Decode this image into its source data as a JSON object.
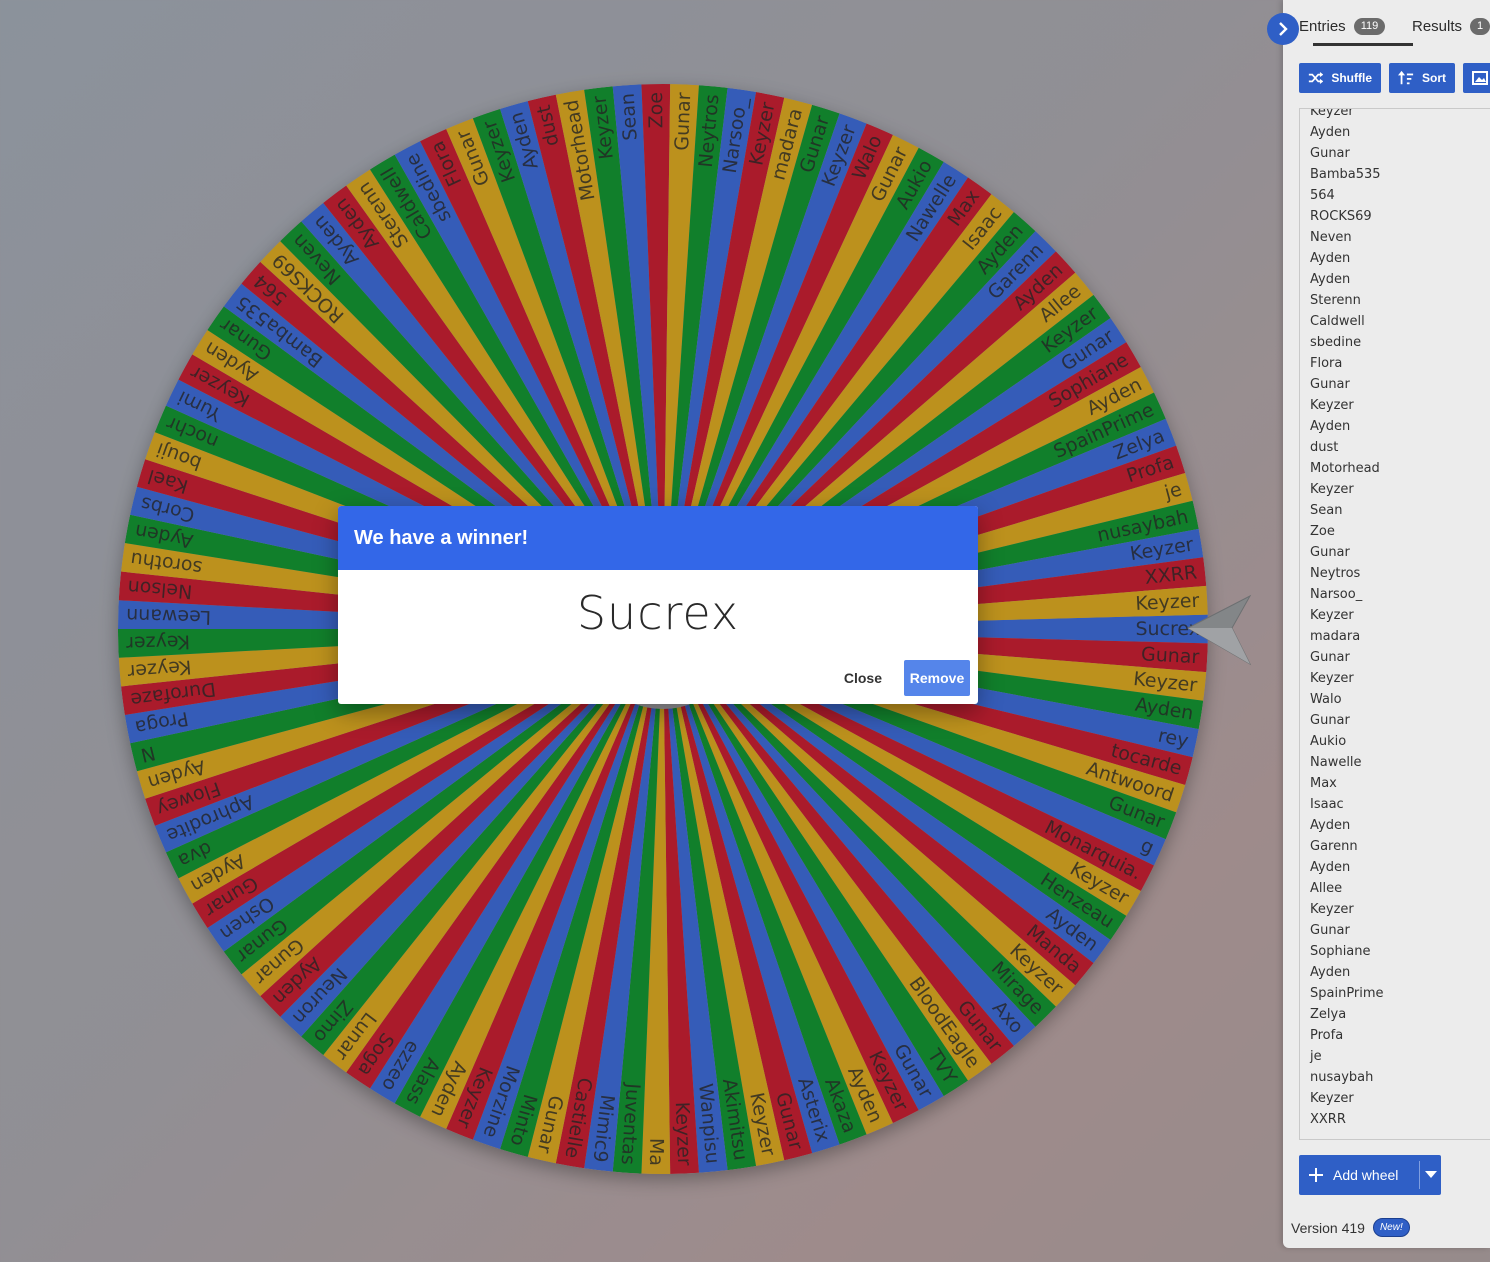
{
  "wheel": {
    "colors": [
      "#3369e8",
      "#d50f25",
      "#eeb211",
      "#009925"
    ],
    "segments": [
      "Sucrex",
      "Gunar",
      "Keyzer",
      "Ayden",
      "rey",
      "tocarde",
      "Antwoord",
      "Gunar",
      "g",
      "Monarquia.",
      "Keyzer",
      "Henzeau",
      "Ayden",
      "Manda",
      "Keyzer",
      "Mirage",
      "Axo",
      "Gunar",
      "BloodEagle",
      "TVY",
      "Gunar",
      "Keyzer",
      "Ayden",
      "Akaza",
      "Asterix",
      "Gunar",
      "Keyzer",
      "Akimitsu",
      "Wanpisu",
      "Keyzer",
      "Ma",
      "Juventas",
      "Mimic9",
      "Castielle",
      "Gunar",
      "Minto",
      "Morzine",
      "Keyzer",
      "Ayden",
      "Alass",
      "ezzeo",
      "Soga",
      "Lunar",
      "Zimo",
      "Neuron",
      "Ayden",
      "Gunar",
      "Gunar",
      "Oshen",
      "Gunar",
      "Ayden",
      "dva",
      "Aphrodite",
      "Flowey",
      "Ayden",
      "N",
      "Proga",
      "Durofaze",
      "Keyzer",
      "Keyzer",
      "Leewann",
      "Nelson",
      "sorothu",
      "Ayden",
      "Corbs",
      "Kael",
      "bouji",
      "nochr",
      "Yumi",
      "Keyzer",
      "Ayden",
      "Gunar",
      "Bamba535",
      "564",
      "ROCKS69",
      "Neven",
      "Ayden",
      "Ayden",
      "Sterenn",
      "Caldwell",
      "sbedine",
      "Flora",
      "Gunar",
      "Keyzer",
      "Ayden",
      "dust",
      "Motorhead",
      "Keyzer",
      "Sean",
      "Zoe",
      "Gunar",
      "Neytros",
      "Narsoo_",
      "Keyzer",
      "madara",
      "Gunar",
      "Keyzer",
      "Walo",
      "Gunar",
      "Aukio",
      "Nawelle",
      "Max",
      "Isaac",
      "Ayden",
      "Garenn",
      "Ayden",
      "Allee",
      "Keyzer",
      "Gunar",
      "Sophiane",
      "Ayden",
      "SpainPrime",
      "Zelya",
      "Profa",
      "je",
      "nusaybah",
      "Keyzer",
      "XXRR",
      "Keyzer"
    ]
  },
  "sidebar": {
    "tabs": {
      "entries_label": "Entries",
      "entries_count": "119",
      "results_label": "Results",
      "results_count": "1"
    },
    "toolbar": {
      "shuffle_label": "Shuffle",
      "sort_label": "Sort"
    },
    "entries": [
      "Keyzer",
      "Ayden",
      "Gunar",
      "Bamba535",
      "564",
      "ROCKS69",
      "Neven",
      "Ayden",
      "Ayden",
      "Sterenn",
      "Caldwell",
      "sbedine",
      "Flora",
      "Gunar",
      "Keyzer",
      "Ayden",
      "dust",
      "Motorhead",
      "Keyzer",
      "Sean",
      "Zoe",
      "Gunar",
      "Neytros",
      "Narsoo_",
      "Keyzer",
      "madara",
      "Gunar",
      "Keyzer",
      "Walo",
      "Gunar",
      "Aukio",
      "Nawelle",
      "Max",
      "Isaac",
      "Ayden",
      "Garenn",
      "Ayden",
      "Allee",
      "Keyzer",
      "Gunar",
      "Sophiane",
      "Ayden",
      "SpainPrime",
      "Zelya",
      "Profa",
      "je",
      "nusaybah",
      "Keyzer",
      "XXRR"
    ],
    "add_wheel_label": "Add wheel",
    "version_label": "Version 419",
    "new_badge": "New!"
  },
  "dialog": {
    "title": "We have a winner!",
    "winner": "Sucrex",
    "close_label": "Close",
    "remove_label": "Remove"
  }
}
